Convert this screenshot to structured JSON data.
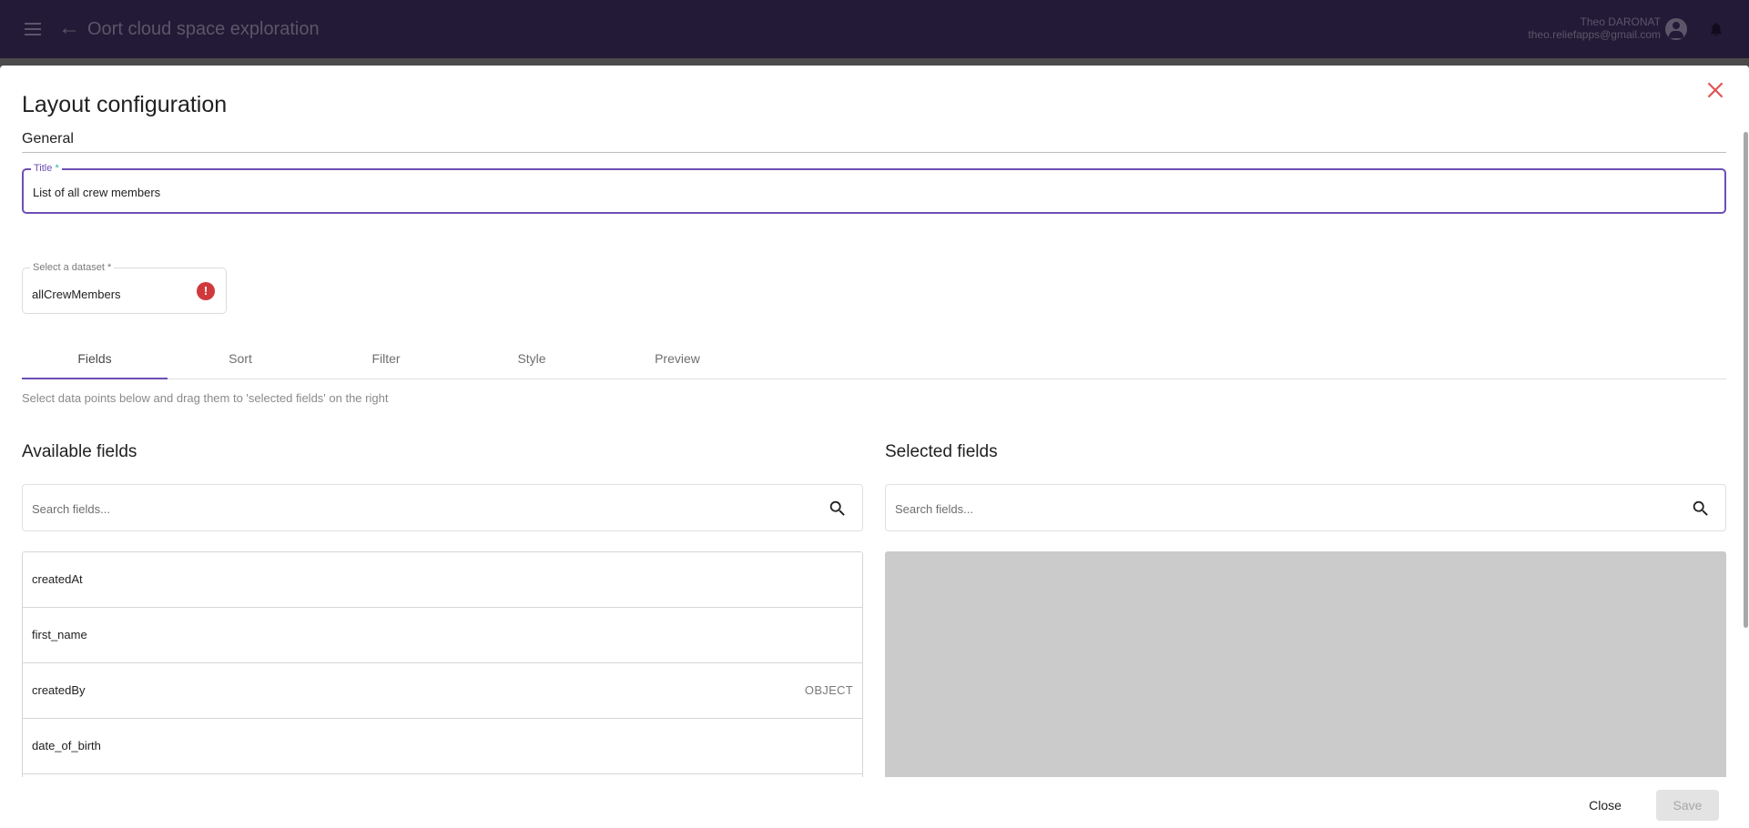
{
  "header": {
    "app_title": "Oort cloud space exploration",
    "user_name": "Theo DARONAT",
    "user_email": "theo.reliefapps@gmail.com",
    "icons": {
      "menu": "menu-icon",
      "back": "arrow-back-icon",
      "account": "account-circle-icon",
      "notifications": "bell-icon"
    }
  },
  "dialog": {
    "title": "Layout configuration",
    "close_icon": "close-icon",
    "colors": {
      "accent": "#6d4fb5",
      "error": "#d0393c",
      "close": "#e05252",
      "required_mark": "#26b5ac"
    },
    "general": {
      "section_label": "General",
      "title_field": {
        "label": "Title",
        "required_mark": "*",
        "value": "List of all crew members"
      },
      "dataset_field": {
        "label": "Select a dataset *",
        "value": "allCrewMembers",
        "status_icon": "error-icon",
        "status_glyph": "!"
      }
    },
    "tabs": [
      {
        "label": "Fields",
        "active": true
      },
      {
        "label": "Sort",
        "active": false
      },
      {
        "label": "Filter",
        "active": false
      },
      {
        "label": "Style",
        "active": false
      },
      {
        "label": "Preview",
        "active": false
      }
    ],
    "fields_tab": {
      "helper_text": "Select data points below and drag them to 'selected fields' on the right",
      "available": {
        "title": "Available fields",
        "search_placeholder": "Search fields...",
        "items": [
          {
            "name": "createdAt",
            "type": ""
          },
          {
            "name": "first_name",
            "type": ""
          },
          {
            "name": "createdBy",
            "type": "OBJECT"
          },
          {
            "name": "date_of_birth",
            "type": ""
          }
        ]
      },
      "selected": {
        "title": "Selected fields",
        "search_placeholder": "Search fields...",
        "items": []
      }
    },
    "footer": {
      "close_label": "Close",
      "save_label": "Save",
      "save_disabled": true
    }
  }
}
